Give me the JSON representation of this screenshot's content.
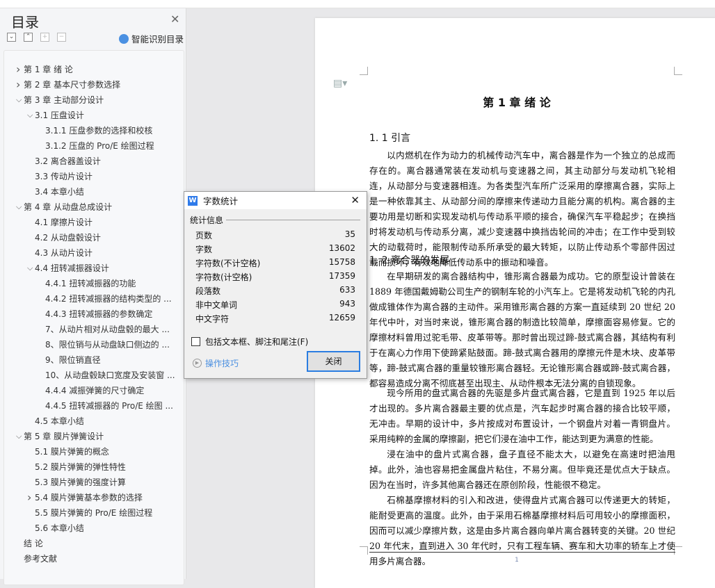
{
  "sidebar": {
    "title": "目录",
    "smart_label": "智能识别目录",
    "items": [
      {
        "label": "第 1 章  绪    论",
        "level": 0,
        "arrow": "right"
      },
      {
        "label": "第 2 章  基本尺寸参数选择",
        "level": 0,
        "arrow": "right"
      },
      {
        "label": "第 3 章  主动部分设计",
        "level": 0,
        "arrow": "down"
      },
      {
        "label": "3.1 压盘设计",
        "level": 1,
        "arrow": "down"
      },
      {
        "label": "3.1.1 压盘参数的选择和校核",
        "level": 2,
        "arrow": ""
      },
      {
        "label": "3.1.2 压盘的 Pro/E 绘图过程",
        "level": 2,
        "arrow": ""
      },
      {
        "label": "3.2 离合器盖设计",
        "level": 1,
        "arrow": ""
      },
      {
        "label": "3.3 传动片设计",
        "level": 1,
        "arrow": ""
      },
      {
        "label": "3.4 本章小结",
        "level": 1,
        "arrow": ""
      },
      {
        "label": "第 4 章  从动盘总成设计",
        "level": 0,
        "arrow": "down"
      },
      {
        "label": "4.1 摩擦片设计",
        "level": 1,
        "arrow": ""
      },
      {
        "label": "4.2 从动盘毂设计",
        "level": 1,
        "arrow": ""
      },
      {
        "label": "4.3 从动片设计",
        "level": 1,
        "arrow": ""
      },
      {
        "label": "4.4 扭转减振器设计",
        "level": 1,
        "arrow": "down"
      },
      {
        "label": "4.4.1 扭转减振器的功能",
        "level": 2,
        "arrow": ""
      },
      {
        "label": "4.4.2  扭转减振器的结构类型的 ...",
        "level": 2,
        "arrow": ""
      },
      {
        "label": "4.4.3 扭转减振器的参数确定",
        "level": 2,
        "arrow": ""
      },
      {
        "label": "7、从动片相对从动盘毂的最大 ...",
        "level": 2,
        "arrow": ""
      },
      {
        "label": "8、限位销与从动盘缺口侧边的 ...",
        "level": 2,
        "arrow": ""
      },
      {
        "label": "9、限位销直径",
        "level": 2,
        "arrow": ""
      },
      {
        "label": "10、从动盘毂缺口宽度及安装窗 ...",
        "level": 2,
        "arrow": ""
      },
      {
        "label": "4.4.4 减振弹簧的尺寸确定",
        "level": 2,
        "arrow": ""
      },
      {
        "label": "4.4.5 扭转减振器的 Pro/E 绘图 ...",
        "level": 2,
        "arrow": ""
      },
      {
        "label": "4.5 本章小结",
        "level": 1,
        "arrow": ""
      },
      {
        "label": "第 5 章  膜片弹簧设计",
        "level": 0,
        "arrow": "down"
      },
      {
        "label": "5.1 膜片弹簧的概念",
        "level": 1,
        "arrow": ""
      },
      {
        "label": "5.2 膜片弹簧的弹性特性",
        "level": 1,
        "arrow": ""
      },
      {
        "label": "5.3 膜片弹簧的强度计算",
        "level": 1,
        "arrow": ""
      },
      {
        "label": "5.4 膜片弹簧基本参数的选择",
        "level": 1,
        "arrow": "right"
      },
      {
        "label": "5.5 膜片弹簧的 Pro/E 绘图过程",
        "level": 1,
        "arrow": ""
      },
      {
        "label": "5.6 本章小结",
        "level": 1,
        "arrow": ""
      },
      {
        "label": "结    论",
        "level": 0,
        "arrow": ""
      },
      {
        "label": "参考文献",
        "level": 0,
        "arrow": ""
      }
    ]
  },
  "document": {
    "title": "第 1 章  绪    论",
    "h1": "1. 1 引言",
    "h2": "1. 2 离合器的发展",
    "page_number": "1",
    "p1": "以内燃机在作为动力的机械传动汽车中，离合器是作为一个独立的总成而存在的。离合器通常装在发动机与变速器之间，其主动部分与发动机飞轮相连，从动部分与变速器相连。为各类型汽车所广泛采用的摩擦离合器，实际上是一种依靠其主、从动部分间的摩擦来传递动力且能分离的机构。离合器的主要功用是切断和实现发动机与传动系平顺的接合，确保汽车平稳起步；在换挡时将发动机与传动系分离，减少变速器中换挡齿轮间的冲击；在工作中受到较大的动载荷时，能限制传动系所承受的最大转矩，以防止传动系个零部件因过载而损坏；有效地降低传动系中的振动和噪音。",
    "p2": "在早期研发的离合器结构中，锥形离合器最为成功。它的原型设计曾装在 1889 年德国戴姆勒公司生产的钢制车轮的小汽车上。它是将发动机飞轮的内孔做成锥体作为离合器的主动件。采用锥形离合器的方案一直延续到 20 世纪 20 年代中叶，对当时来说，锥形离合器的制造比较简单，摩擦面容易修复。它的摩擦材料曾用过驼毛带、皮革带等。那时曾出现过蹄-鼓式离合器，其结构有利于在离心力作用下使蹄紧贴鼓面。蹄-鼓式离合器用的摩擦元件是木块、皮革带等，蹄-鼓式离合器的重量较锥形离合器轻。无论锥形离合器或蹄-鼓式离合器，都容易造成分离不彻底甚至出现主、从动件根本无法分离的自锁现象。",
    "p3": "现今所用的盘式离合器的先驱是多片盘式离合器，它是直到 1925 年以后才出现的。多片离合器最主要的优点是，汽车起步时离合器的接合比较平顺，无冲击。早期的设计中，多片按成对布置设计，一个钢盘片对着一青铜盘片。采用纯粹的金属的摩擦副，把它们浸在油中工作，能达到更为满意的性能。",
    "p4": "浸在油中的盘片式离合器，盘子直径不能太大，以避免在高速时把油甩掉。此外，油也容易把金属盘片粘住，不易分离。但毕竟还是优点大于缺点。因为在当时，许多其他离合器还在原创阶段，性能很不稳定。",
    "p5": "石棉基摩擦材料的引入和改进，使得盘片式离合器可以传递更大的转矩，能耐受更高的温度。此外，由于采用石棉基摩擦材料后可用较小的摩擦面积，因而可以减少摩擦片数，这是由多片离合器向单片离合器转变的关键。20 世纪 20 年代末，直到进入 30 年代时，只有工程车辆、赛车和大功率的轿车上才使用多片离合器。"
  },
  "dialog": {
    "title": "字数统计",
    "group": "统计信息",
    "stats": [
      {
        "label": "页数",
        "value": "35"
      },
      {
        "label": "字数",
        "value": "13602"
      },
      {
        "label": "字符数(不计空格)",
        "value": "15758"
      },
      {
        "label": "字符数(计空格)",
        "value": "17359"
      },
      {
        "label": "段落数",
        "value": "633"
      },
      {
        "label": "非中文单词",
        "value": "943"
      },
      {
        "label": "中文字符",
        "value": "12659"
      }
    ],
    "checkbox_label": "包括文本框、脚注和尾注(F)",
    "tips_label": "操作技巧",
    "close_label": "关闭"
  }
}
